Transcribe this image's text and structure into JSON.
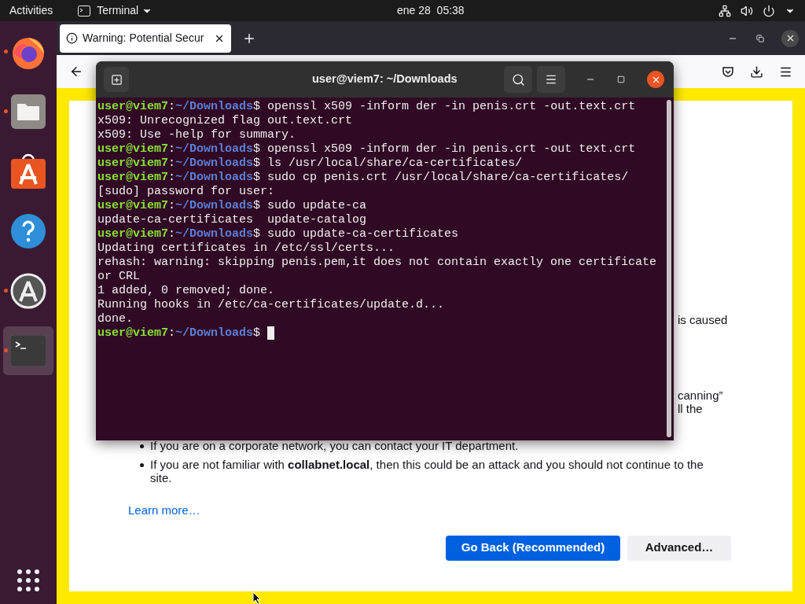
{
  "top_bar": {
    "activities": "Activities",
    "app_menu": "Terminal",
    "clock": "ene 28  05:38"
  },
  "dock": [
    {
      "kind": "firefox",
      "running": true,
      "selected": false
    },
    {
      "kind": "files",
      "running": true,
      "selected": false
    },
    {
      "kind": "software",
      "running": false,
      "selected": false
    },
    {
      "kind": "help",
      "running": false,
      "selected": false
    },
    {
      "kind": "updater",
      "running": true,
      "selected": false
    },
    {
      "kind": "terminal",
      "running": true,
      "selected": true
    }
  ],
  "browser": {
    "tabs": [
      {
        "title": "Warning: Potential Secur",
        "selected": true
      }
    ],
    "fragments": [
      [
        "is caused"
      ],
      [
        "canning”",
        "ll the"
      ]
    ],
    "bullets": [
      "If you are on a corporate network, you can contact your IT department.",
      "If you are not familiar with **collabnet.local**, then this could be an attack and you should not continue to the site."
    ],
    "learn_more": "Learn more…",
    "buttons": [
      {
        "label": "Go Back (Recommended)",
        "kind": "primary"
      },
      {
        "label": "Advanced…",
        "kind": "secondary"
      }
    ]
  },
  "terminal": {
    "title": "user@viem7: ~/Downloads",
    "lines": [
      {
        "kind": "prompt",
        "user": "user@viem7",
        "separator": ":",
        "path": "~/Downloads",
        "symbol": "$",
        "command": "openssl x509 -inform der -in penis.crt -out.text.crt"
      },
      {
        "kind": "output",
        "text": "x509: Unrecognized flag out.text.crt"
      },
      {
        "kind": "output",
        "text": "x509: Use -help for summary."
      },
      {
        "kind": "prompt",
        "user": "user@viem7",
        "separator": ":",
        "path": "~/Downloads",
        "symbol": "$",
        "command": "openssl x509 -inform der -in penis.crt -out text.crt"
      },
      {
        "kind": "prompt",
        "user": "user@viem7",
        "separator": ":",
        "path": "~/Downloads",
        "symbol": "$",
        "command": "ls /usr/local/share/ca-certificates/"
      },
      {
        "kind": "prompt",
        "user": "user@viem7",
        "separator": ":",
        "path": "~/Downloads",
        "symbol": "$",
        "command": "sudo cp penis.crt /usr/local/share/ca-certificates/"
      },
      {
        "kind": "output",
        "text": "[sudo] password for user:"
      },
      {
        "kind": "prompt",
        "user": "user@viem7",
        "separator": ":",
        "path": "~/Downloads",
        "symbol": "$",
        "command": "sudo update-ca"
      },
      {
        "kind": "output",
        "text": "update-ca-certificates  update-catalog"
      },
      {
        "kind": "prompt",
        "user": "user@viem7",
        "separator": ":",
        "path": "~/Downloads",
        "symbol": "$",
        "command": "sudo update-ca-certificates"
      },
      {
        "kind": "output",
        "text": "Updating certificates in /etc/ssl/certs..."
      },
      {
        "kind": "output",
        "text": "rehash: warning: skipping penis.pem,it does not contain exactly one certificate"
      },
      {
        "kind": "output",
        "text": "or CRL"
      },
      {
        "kind": "output",
        "text": "1 added, 0 removed; done."
      },
      {
        "kind": "output",
        "text": "Running hooks in /etc/ca-certificates/update.d..."
      },
      {
        "kind": "output",
        "text": "done."
      },
      {
        "kind": "prompt",
        "user": "user@viem7",
        "separator": ":",
        "path": "~/Downloads",
        "symbol": "$",
        "cursor": true
      }
    ]
  }
}
